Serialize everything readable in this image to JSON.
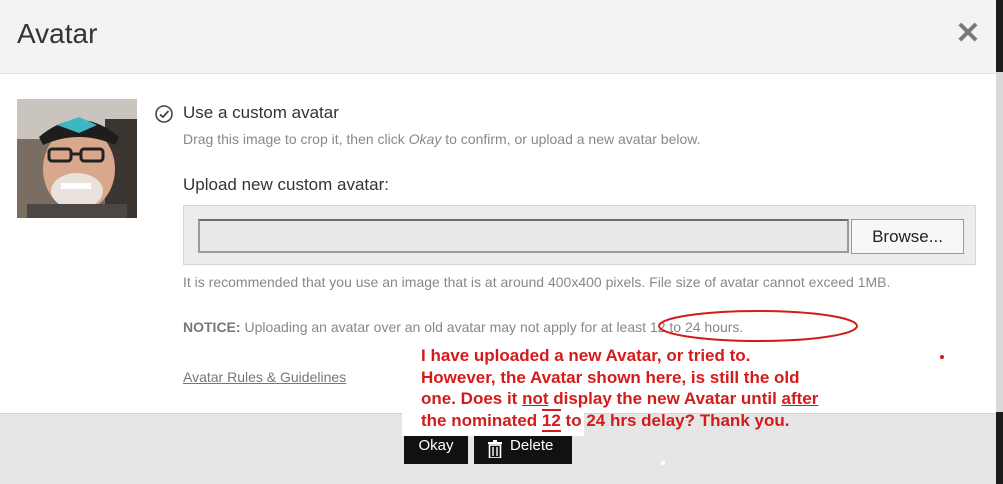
{
  "dialog": {
    "title": "Avatar",
    "close_icon": "close-icon"
  },
  "custom_avatar": {
    "option_label": "Use a custom avatar",
    "desc_before": "Drag this image to crop it, then click ",
    "desc_em": "Okay",
    "desc_after": " to confirm, or upload a new avatar below."
  },
  "upload": {
    "title": "Upload new custom avatar:",
    "file_value": "",
    "browse_label": "Browse...",
    "recommendation": "It is recommended that you use an image that is at around 400x400 pixels. File size of avatar cannot exceed 1MB.",
    "notice_label": "NOTICE:",
    "notice_text": " Uploading an avatar over an old avatar may not apply for at least 12 to 24 hours."
  },
  "links": {
    "rules": "Avatar Rules & Guidelines"
  },
  "footer": {
    "okay_label": "Okay",
    "delete_label": "Delete"
  },
  "annotation": {
    "line1": "I have uploaded a new Avatar, or tried to.",
    "line2": "However, the Avatar shown here, is still the old",
    "line3_a": "one.  Does it ",
    "line3_not": "not",
    "line3_b": " display the new Avatar until ",
    "line3_after": "after",
    "line4_a": "the nominated ",
    "line4_12": "12",
    "line4_b": " to 24 hrs delay? Thank you."
  },
  "colors": {
    "annotation_red": "#d41b1b",
    "button_black": "#111111",
    "header_bg": "#f3f3f3",
    "footer_bg": "#e6e6e6"
  }
}
